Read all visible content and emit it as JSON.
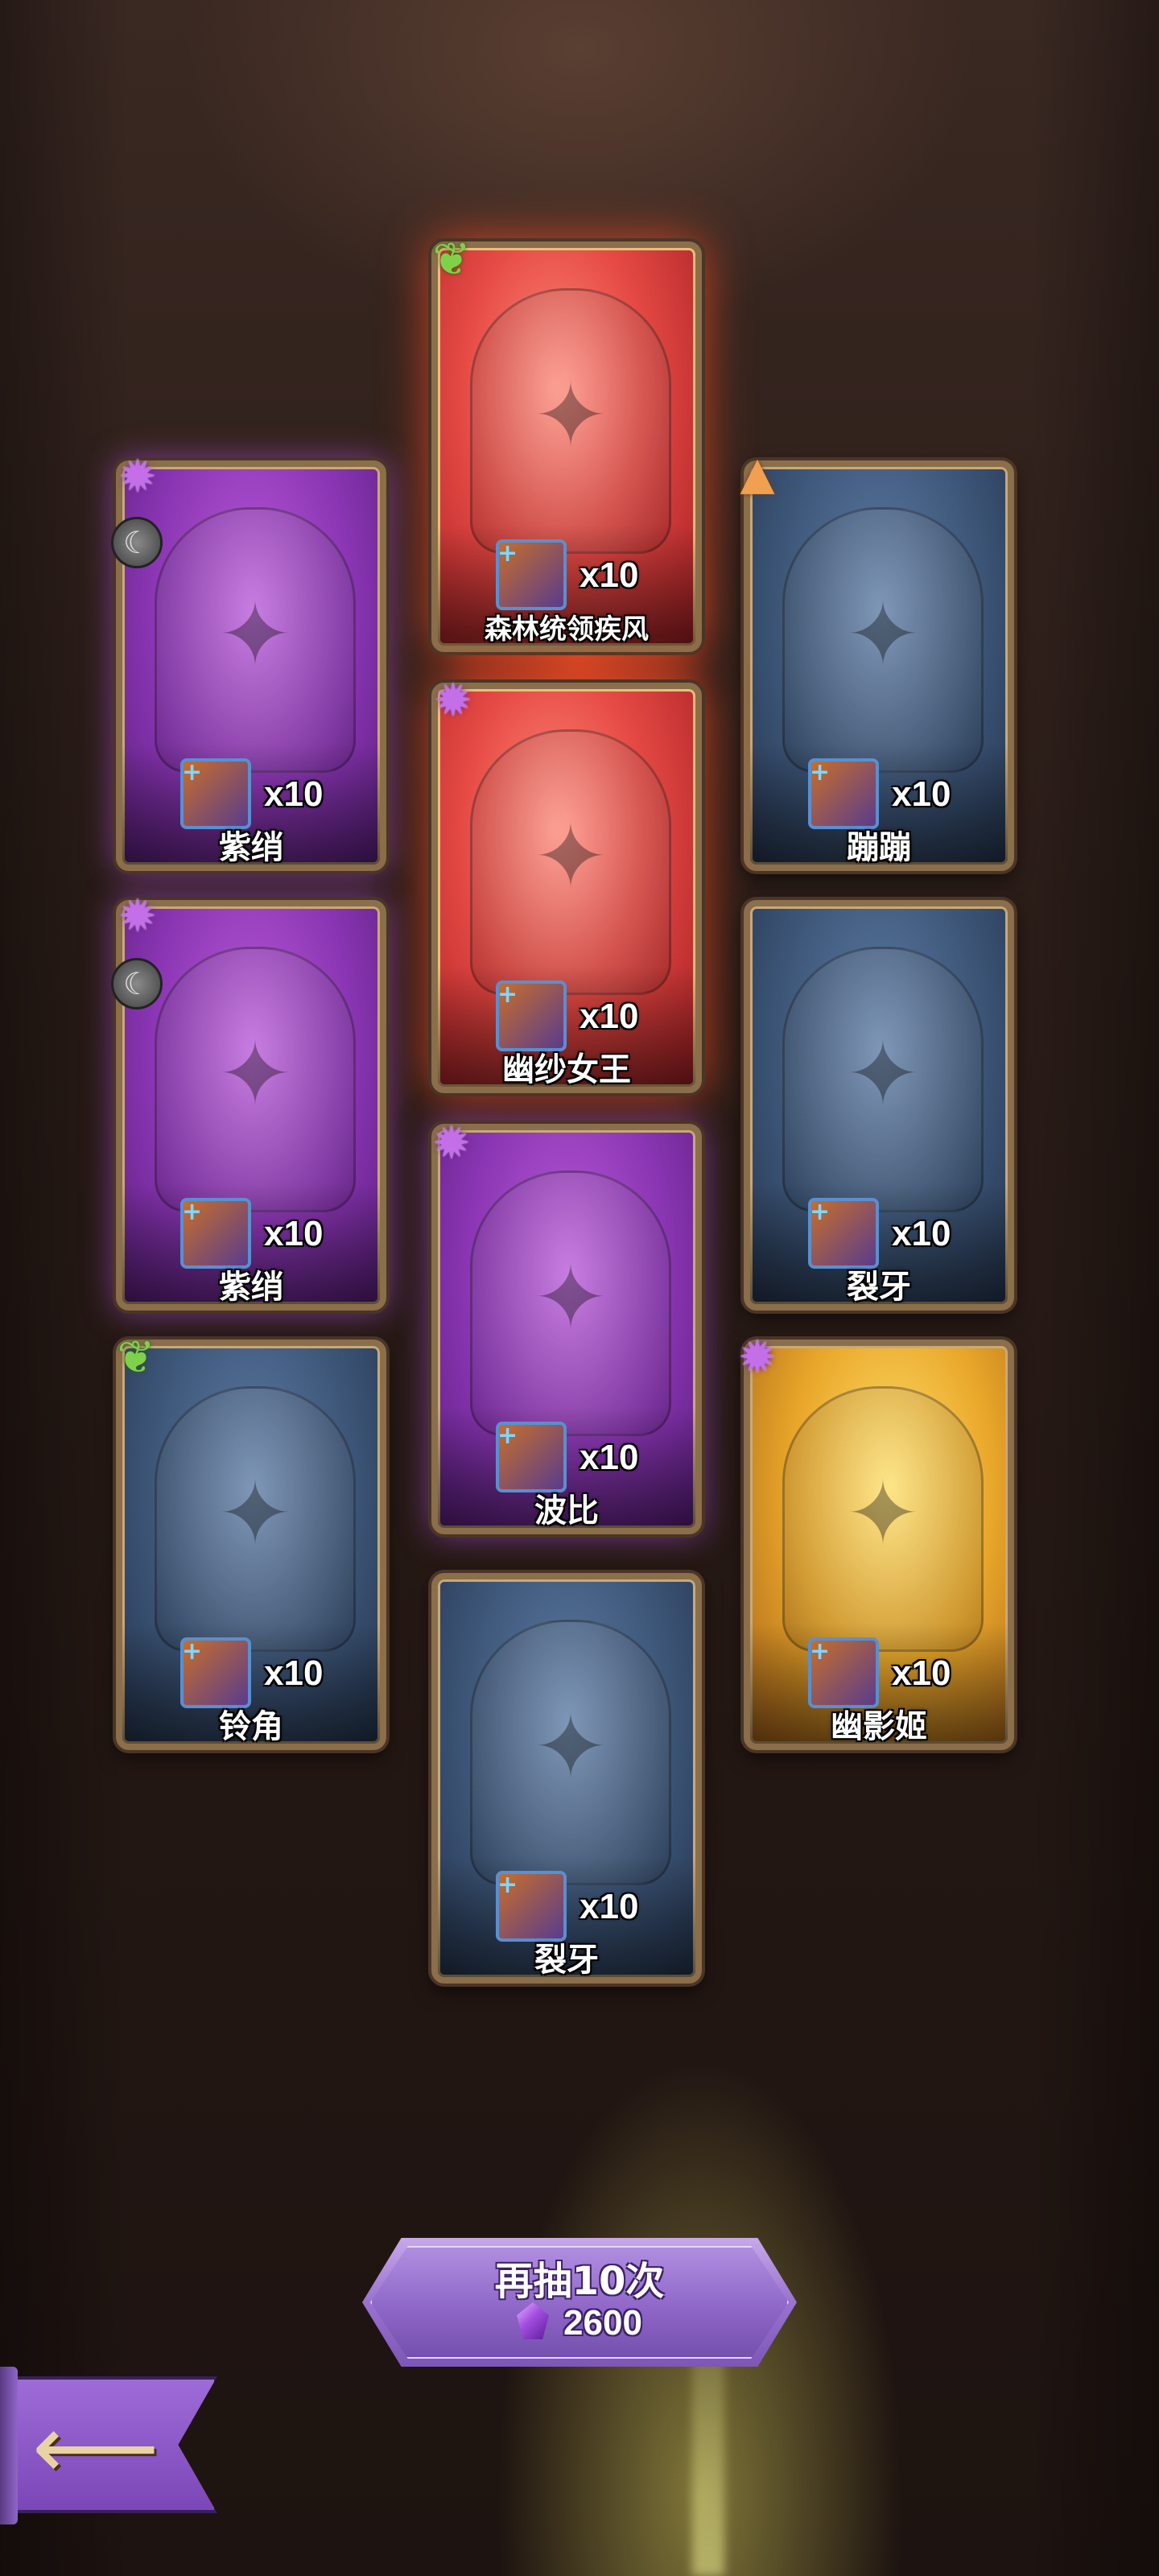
{
  "result_cards": [
    {
      "id": "forest-leader",
      "name": "森林统领疾风",
      "count": "x10",
      "rarity": "legendary",
      "faction_icon": "leaf-icon",
      "bg": "red"
    },
    {
      "id": "ziqiao-1",
      "name": "紫绡",
      "count": "x10",
      "rarity": "epic",
      "faction_icon": "shadow-splat-icon",
      "class_icon": "crescent-moon-icon",
      "bg": "purple"
    },
    {
      "id": "bengbeng",
      "name": "蹦蹦",
      "count": "x10",
      "rarity": "rare",
      "faction_icon": "mountain-icon",
      "bg": "blue"
    },
    {
      "id": "youshanuwang",
      "name": "幽纱女王",
      "count": "x10",
      "rarity": "legendary",
      "faction_icon": "shadow-splat-icon",
      "bg": "red"
    },
    {
      "id": "ziqiao-2",
      "name": "紫绡",
      "count": "x10",
      "rarity": "epic",
      "faction_icon": "shadow-splat-icon",
      "class_icon": "crescent-moon-icon",
      "bg": "purple"
    },
    {
      "id": "lieya-1",
      "name": "裂牙",
      "count": "x10",
      "rarity": "rare",
      "bg": "blue"
    },
    {
      "id": "bobi",
      "name": "波比",
      "count": "x10",
      "rarity": "epic",
      "faction_icon": "shadow-splat-icon",
      "bg": "purple"
    },
    {
      "id": "lingjiao",
      "name": "铃角",
      "count": "x10",
      "rarity": "rare",
      "faction_icon": "leaf-icon",
      "bg": "blue"
    },
    {
      "id": "youyingji",
      "name": "幽影姬",
      "count": "x10",
      "rarity": "legendary",
      "faction_icon": "shadow-splat-icon",
      "bg": "gold"
    },
    {
      "id": "lieya-2",
      "name": "裂牙",
      "count": "x10",
      "rarity": "rare",
      "bg": "blue"
    }
  ],
  "redraw_button": {
    "label": "再抽10次",
    "cost": "2600",
    "currency_icon": "purple-gem-icon"
  },
  "back_button": {
    "icon": "back-arrow-icon"
  },
  "colors": {
    "card_border": "#8b6e4a",
    "epic_purple": "#8a35b3",
    "rare_blue": "#3d5678",
    "legend_red": "#e64a44",
    "legend_gold": "#e9a72a",
    "button_purple": "#9a72cf"
  }
}
